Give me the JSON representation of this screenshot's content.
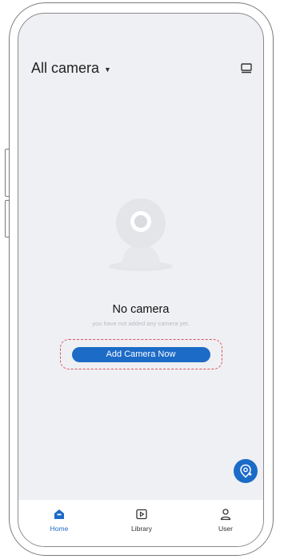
{
  "header": {
    "title": "All camera",
    "dropdown_icon": "caret-down-icon",
    "right_icon": "monitor-icon"
  },
  "empty_state": {
    "illustration_icon": "webcam-icon",
    "title": "No camera",
    "subtitle": "you have not added any camera yet.",
    "button_label": "Add Camera Now"
  },
  "fab": {
    "icon": "add-camera-icon"
  },
  "tabbar": {
    "items": [
      {
        "label": "Home",
        "icon": "home-icon",
        "active": true
      },
      {
        "label": "Library",
        "icon": "library-icon",
        "active": false
      },
      {
        "label": "User",
        "icon": "user-icon",
        "active": false
      }
    ]
  },
  "colors": {
    "accent": "#1c6bc7",
    "screen_bg": "#eef0f3",
    "highlight_dash": "#e05060"
  }
}
